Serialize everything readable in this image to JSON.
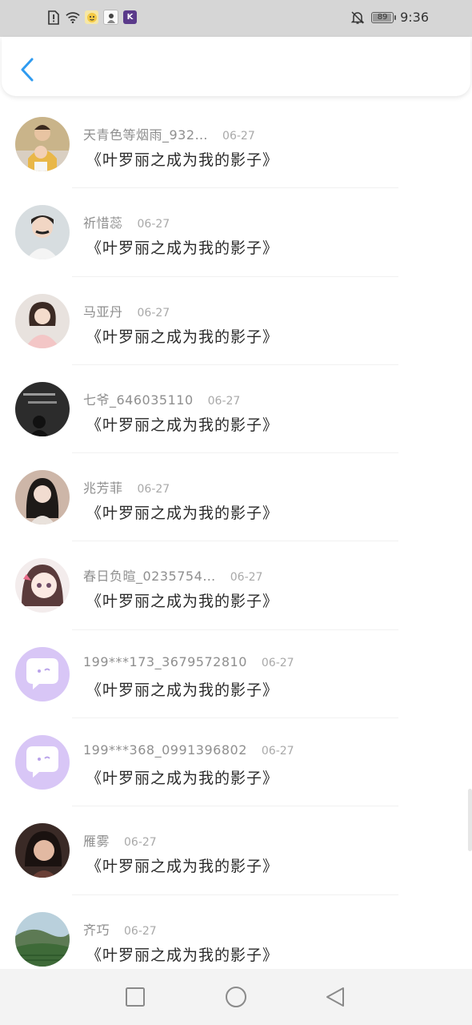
{
  "status_bar": {
    "time": "9:36",
    "battery": "89",
    "app_badge": "K"
  },
  "header": {
    "back_icon": "chevron-left-icon"
  },
  "list": [
    {
      "name": "天青色等烟雨_932…",
      "date": "06-27",
      "book": "《叶罗丽之成为我的影子》",
      "avatar": "photo-mother-child"
    },
    {
      "name": "祈惜蕊",
      "date": "06-27",
      "book": "《叶罗丽之成为我的影子》",
      "avatar": "photo-boy"
    },
    {
      "name": "马亚丹",
      "date": "06-27",
      "book": "《叶罗丽之成为我的影子》",
      "avatar": "photo-girl-pink"
    },
    {
      "name": "七爷_646035110",
      "date": "06-27",
      "book": "《叶罗丽之成为我的影子》",
      "avatar": "photo-dark-text"
    },
    {
      "name": "兆芳菲",
      "date": "06-27",
      "book": "《叶罗丽之成为我的影子》",
      "avatar": "photo-girl-portrait"
    },
    {
      "name": "春日负暄_0235754…",
      "date": "06-27",
      "book": "《叶罗丽之成为我的影子》",
      "avatar": "anime-girl"
    },
    {
      "name": "199***173_3679572810",
      "date": "06-27",
      "book": "《叶罗丽之成为我的影子》",
      "avatar": "default-chat-avatar"
    },
    {
      "name": "199***368_0991396802",
      "date": "06-27",
      "book": "《叶罗丽之成为我的影子》",
      "avatar": "default-chat-avatar"
    },
    {
      "name": "雁雾",
      "date": "06-27",
      "book": "《叶罗丽之成为我的影子》",
      "avatar": "photo-dark-portrait"
    },
    {
      "name": "齐巧",
      "date": "06-27",
      "book": "《叶罗丽之成为我的影子》",
      "avatar": "photo-landscape"
    }
  ],
  "colors": {
    "accent": "#2f9bf0",
    "default_avatar_bg": "#d8c6f6",
    "name_text": "#8f8f8f",
    "title_text": "#2a2a2a"
  }
}
